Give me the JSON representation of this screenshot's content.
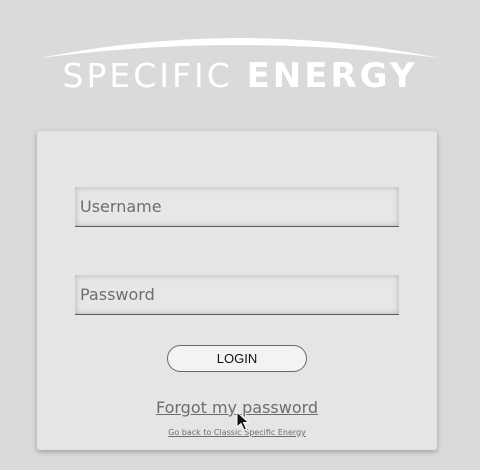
{
  "logo": {
    "word1": "SPECIFIC",
    "word2": "ENERGY"
  },
  "login_form": {
    "username_placeholder": "Username",
    "password_placeholder": "Password",
    "login_label": "LOGIN",
    "forgot_password_label": "Forgot my password",
    "classic_link_label": "Go back to Classic Specific Energy"
  },
  "colors": {
    "background": "#dbdadb",
    "card": "#e6e4e5",
    "logo": "#ffffff",
    "link": "#6d6d6d"
  },
  "icons": {
    "cursor": "mouse-pointer-icon"
  }
}
